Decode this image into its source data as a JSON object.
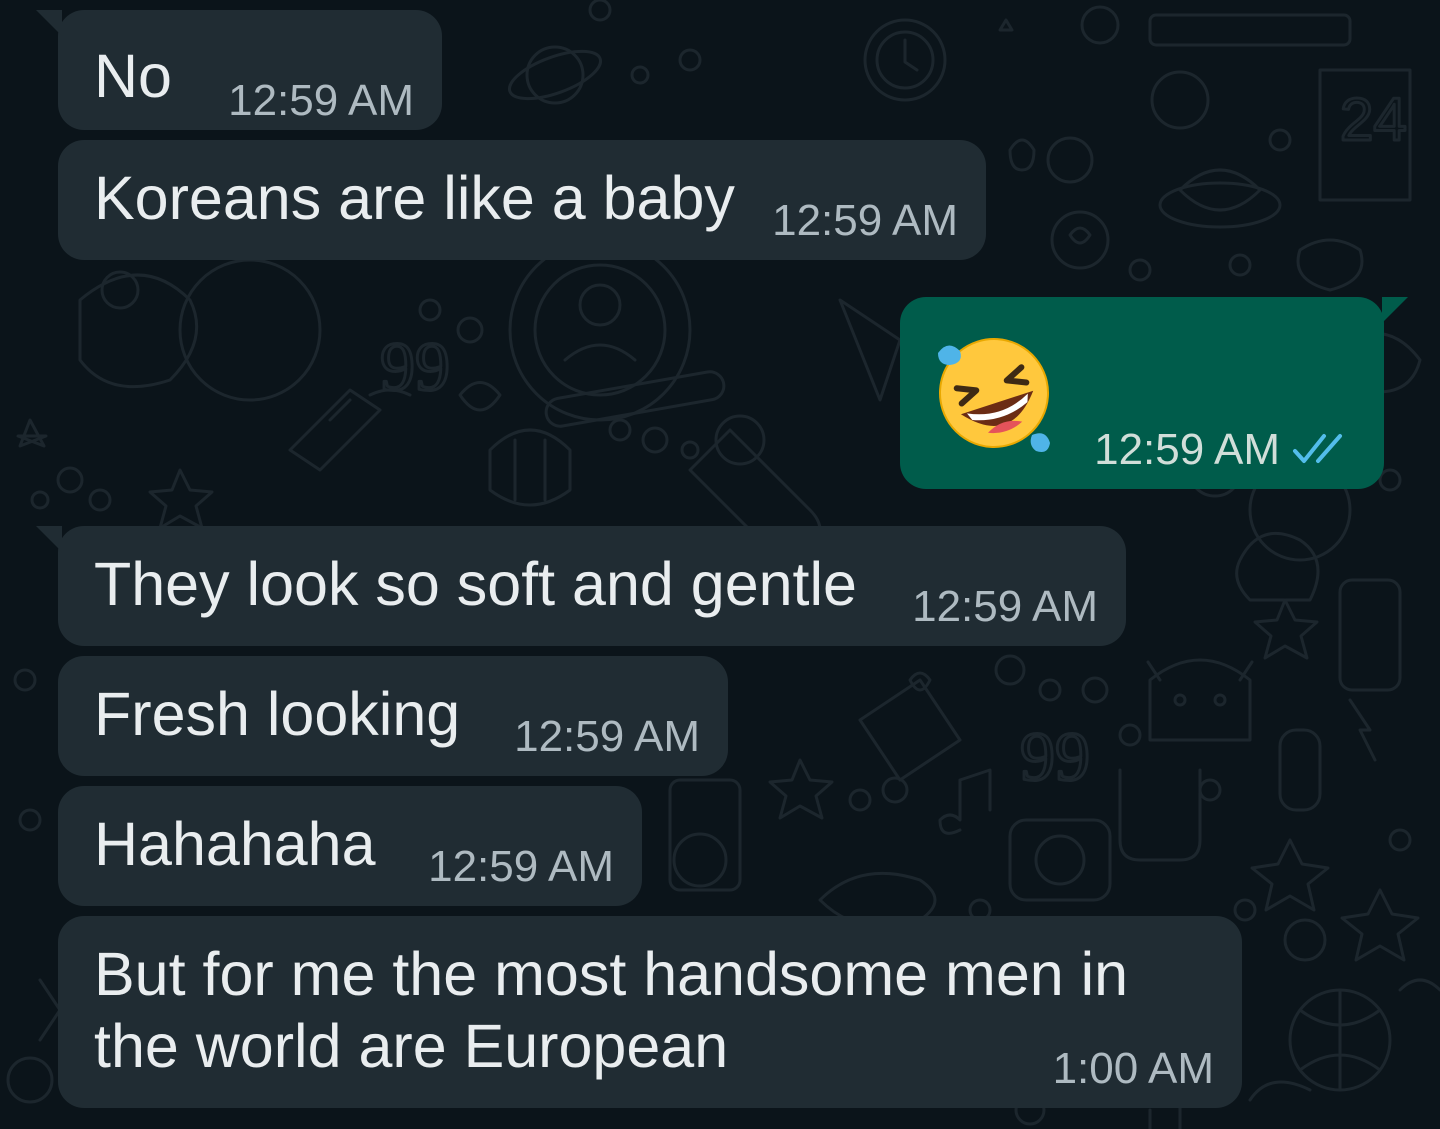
{
  "messages": [
    {
      "direction": "incoming",
      "text": "No",
      "time": "12:59 AM"
    },
    {
      "direction": "incoming",
      "text": "Koreans are like a baby",
      "time": "12:59 AM"
    },
    {
      "direction": "outgoing",
      "emoji": "rolling-on-floor-laughing-emoji",
      "time": "12:59 AM",
      "status": "read"
    },
    {
      "direction": "incoming",
      "text": "They look so soft and gentle",
      "time": "12:59 AM"
    },
    {
      "direction": "incoming",
      "text": "Fresh looking",
      "time": "12:59 AM"
    },
    {
      "direction": "incoming",
      "text": "Hahahaha",
      "time": "12:59 AM"
    },
    {
      "direction": "incoming",
      "text_lines": [
        "But for me the most handsome men in",
        "the world are European"
      ],
      "time": "1:00 AM"
    }
  ],
  "colors": {
    "background": "#0b141a",
    "incoming_bubble": "#202c33",
    "outgoing_bubble": "#005c4b",
    "text": "#e9edef",
    "time_text": "#aebac1",
    "read_ticks": "#53bdeb"
  }
}
